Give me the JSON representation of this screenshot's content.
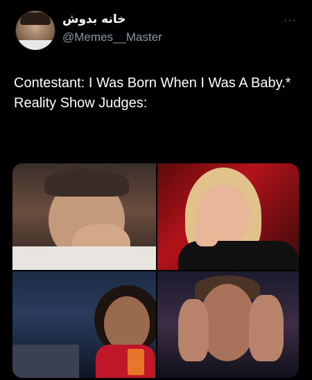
{
  "user": {
    "display_name": "خانه بدوش",
    "handle": "@Memes__Master"
  },
  "more_label": "···",
  "tweet": {
    "line1": "Contestant: I Was Born When  I Was A Baby.*",
    "line2": "Reality Show Judges:"
  },
  "media": {
    "tiles": [
      "judge-crying-1",
      "judge-crying-2",
      "judge-crying-3",
      "judge-crying-4"
    ]
  }
}
